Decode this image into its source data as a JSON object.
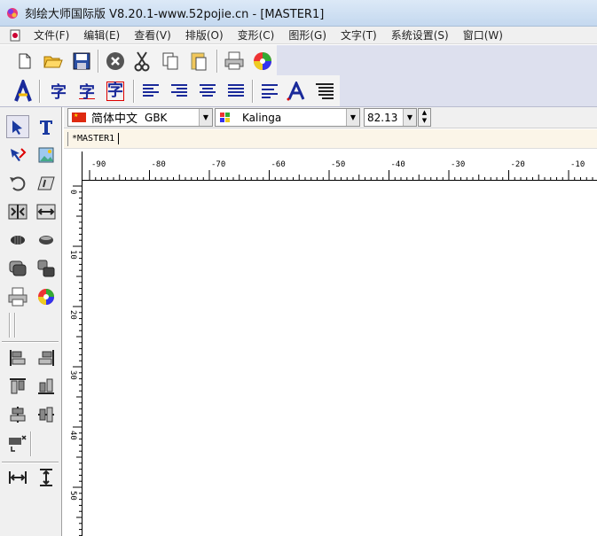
{
  "window": {
    "title": "刻绘大师国际版 V8.20.1-www.52pojie.cn - [MASTER1]"
  },
  "menu": {
    "items": [
      "文件(F)",
      "编辑(E)",
      "查看(V)",
      "排版(O)",
      "变形(C)",
      "图形(G)",
      "文字(T)",
      "系统设置(S)",
      "窗口(W)"
    ]
  },
  "toolbar1": [
    "new-file-icon",
    "open-folder-icon",
    "save-icon",
    "close-circle-icon",
    "cut-icon",
    "copy-icon",
    "paste-icon",
    "print-icon",
    "color-wheel-icon"
  ],
  "toolbar2": {
    "char_label": "字",
    "text_icons": [
      "text-a-icon",
      "char-icon",
      "char-outline-icon",
      "char-box-icon",
      "align-left-icon",
      "align-right-icon",
      "align-center-icon",
      "align-justify-icon",
      "line-spacing-icon",
      "font-a-icon",
      "paragraph-icon"
    ]
  },
  "properties": {
    "language": "简体中文",
    "encoding": "GBK",
    "font": "Kalinga",
    "size": "82.13"
  },
  "document": {
    "tab": "*MASTER1"
  },
  "ruler": {
    "horizontal_ticks": [
      "-90",
      "-80",
      "-70",
      "-60",
      "-50",
      "-40",
      "-30",
      "-20",
      "-10"
    ],
    "vertical_ticks": [
      "0",
      "10",
      "20",
      "30",
      "40",
      "50"
    ]
  },
  "colors": {
    "titlebar": "#c4d8ef",
    "toolbar_bg": "#dde0ee",
    "tab_bg": "#fbf5e8"
  }
}
